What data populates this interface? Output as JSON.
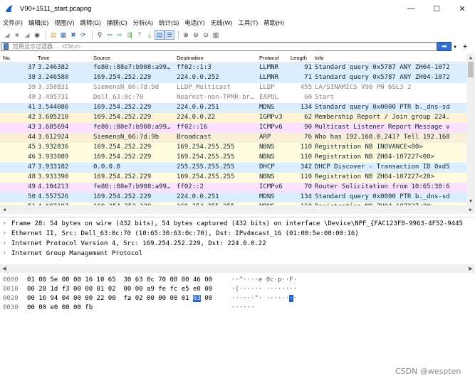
{
  "window": {
    "title": "V90+1511_start.pcapng",
    "minimize": "—",
    "maximize": "☐",
    "close": "✕"
  },
  "menu": [
    "文件(F)",
    "编辑(E)",
    "视图(V)",
    "跳转(G)",
    "捕获(C)",
    "分析(A)",
    "统计(S)",
    "电话(Y)",
    "无线(W)",
    "工具(T)",
    "帮助(H)"
  ],
  "toolbar_icons": [
    "shark-fin-start-icon",
    "stop-square-icon",
    "restart-fin-icon",
    "capture-options-gear-icon",
    "sep",
    "open-file-icon",
    "save-file-icon",
    "close-file-icon",
    "reload-icon",
    "sep",
    "find-packet-icon",
    "go-back-icon",
    "go-forward-icon",
    "go-to-packet-icon",
    "go-first-icon",
    "go-last-icon",
    "autoscroll-icon",
    "colorize-icon",
    "sep",
    "zoom-in-icon",
    "zoom-out-icon",
    "zoom-normal-icon",
    "resize-columns-icon"
  ],
  "filter": {
    "placeholder": "应用显示过滤器 … <Ctrl-/>",
    "apply": "➡",
    "dropdown": "▾",
    "add": "+"
  },
  "packet_list": {
    "columns": [
      "No.",
      "Time",
      "Source",
      "Destination",
      "Protocol",
      "Length",
      "Info"
    ],
    "rows": [
      {
        "no": "37",
        "time": "3.246382",
        "src": "fe80::88e7:b908:a99…",
        "dst": "ff02::1:3",
        "proto": "LLMNR",
        "len": "91",
        "info": "Standard query 0x5787 ANY ZH04-1072",
        "bg": "#daeeff",
        "fg": "#12272e"
      },
      {
        "no": "38",
        "time": "3.246580",
        "src": "169.254.252.229",
        "dst": "224.0.0.252",
        "proto": "LLMNR",
        "len": "71",
        "info": "Standard query 0x5787 ANY ZH04-1072",
        "bg": "#daeeff",
        "fg": "#12272e"
      },
      {
        "no": "39",
        "time": "3.358831",
        "src": "SiemensN_66:7d:9d",
        "dst": "LLDP_Multicast",
        "proto": "LLDP",
        "len": "455",
        "info": "LA/SINAMICS V90 PN            6SL3 2",
        "bg": "#ffffff",
        "fg": "#7f7f7f"
      },
      {
        "no": "40",
        "time": "3.495731",
        "src": "Dell_63:0c:70",
        "dst": "Nearest-non-TPMR-br…",
        "proto": "EAPOL",
        "len": "60",
        "info": "Start",
        "bg": "#ffffff",
        "fg": "#7f7f7f"
      },
      {
        "no": "41",
        "time": "3.544086",
        "src": "169.254.252.229",
        "dst": "224.0.0.251",
        "proto": "MDNS",
        "len": "134",
        "info": "Standard query 0x0000 PTR b._dns-sd",
        "bg": "#daeeff",
        "fg": "#12272e"
      },
      {
        "no": "42",
        "time": "3.605210",
        "src": "169.254.252.229",
        "dst": "224.0.0.22",
        "proto": "IGMPv3",
        "len": "62",
        "info": "Membership Report / Join group 224.",
        "bg": "#fff3d6",
        "fg": "#12272e"
      },
      {
        "no": "43",
        "time": "3.605694",
        "src": "fe80::88e7:b908:a99…",
        "dst": "ff02::16",
        "proto": "ICMPv6",
        "len": "90",
        "info": "Multicast Listener Report Message v",
        "bg": "#fce0ff",
        "fg": "#12272e"
      },
      {
        "no": "44",
        "time": "3.612924",
        "src": "SiemensN_66:7d:9b",
        "dst": "Broadcast",
        "proto": "ARP",
        "len": "76",
        "info": "Who has 192.168.0.241? Tell 192.168",
        "bg": "#faf0d7",
        "fg": "#12272e"
      },
      {
        "no": "45",
        "time": "3.932836",
        "src": "169.254.252.229",
        "dst": "169.254.255.255",
        "proto": "NBNS",
        "len": "110",
        "info": "Registration NB INOVANCE<00>",
        "bg": "#fffce0",
        "fg": "#12272e"
      },
      {
        "no": "46",
        "time": "3.933089",
        "src": "169.254.252.229",
        "dst": "169.254.255.255",
        "proto": "NBNS",
        "len": "110",
        "info": "Registration NB ZH04-107227<00>",
        "bg": "#fffce0",
        "fg": "#12272e"
      },
      {
        "no": "47",
        "time": "3.933182",
        "src": "0.0.0.0",
        "dst": "255.255.255.255",
        "proto": "DHCP",
        "len": "342",
        "info": "DHCP Discover - Transaction ID 0xd5",
        "bg": "#daeeff",
        "fg": "#12272e"
      },
      {
        "no": "48",
        "time": "3.933390",
        "src": "169.254.252.229",
        "dst": "169.254.255.255",
        "proto": "NBNS",
        "len": "110",
        "info": "Registration NB ZH04-107227<20>",
        "bg": "#fffce0",
        "fg": "#12272e"
      },
      {
        "no": "49",
        "time": "4.104213",
        "src": "fe80::88e7:b908:a99…",
        "dst": "ff02::2",
        "proto": "ICMPv6",
        "len": "70",
        "info": "Router Solicitation from 10:65:30:6",
        "bg": "#fce0ff",
        "fg": "#12272e"
      },
      {
        "no": "50",
        "time": "4.557526",
        "src": "169.254.252.229",
        "dst": "224.0.0.251",
        "proto": "MDNS",
        "len": "134",
        "info": "Standard query 0x0000 PTR b._dns-sd",
        "bg": "#daeeff",
        "fg": "#12272e"
      },
      {
        "no": "51",
        "time": "4.697197",
        "src": "169.254.252.229",
        "dst": "169.254.255.255",
        "proto": "NBNS",
        "len": "110",
        "info": "Registration NB ZH04-107227<20>",
        "bg": "#fffce0",
        "fg": "#12272e"
      }
    ]
  },
  "details": [
    {
      "caret": "›",
      "text": "Frame 28: 54 bytes on wire (432 bits), 54 bytes captured (432 bits) on interface \\Device\\NPF_{FAC123F8-9963-4F52-9445"
    },
    {
      "caret": "›",
      "text": "Ethernet II, Src: Dell_63:0c:70 (10:65:30:63:0c:70), Dst: IPv4mcast_16 (01:00:5e:00:00:16)"
    },
    {
      "caret": "›",
      "text": "Internet Protocol Version 4, Src: 169.254.252.229, Dst: 224.0.0.22"
    },
    {
      "caret": "›",
      "text": "Internet Group Management Protocol"
    }
  ],
  "bytes": [
    {
      "offset": "0000",
      "hex_a": "01 00 5e 00 00 16 10 65  30 63 0c 70 08 00 46 00",
      "hex_hl": "",
      "hex_b": "",
      "ascii_a": "··^····e 0c·p··F·",
      "ascii_hl": "",
      "ascii_b": ""
    },
    {
      "offset": "0010",
      "hex_a": "00 28 1d f3 00 00 01 02  00 00 a9 fe fc e5 e0 00",
      "hex_hl": "",
      "hex_b": "",
      "ascii_a": "·(······ ········",
      "ascii_hl": "",
      "ascii_b": ""
    },
    {
      "offset": "0020",
      "hex_a": "00 16 94 04 00 00 22 00  fa 02 00 00 00 01 ",
      "hex_hl": "03",
      "hex_b": " 00",
      "ascii_a": "······\"· ······",
      "ascii_hl": "·",
      "ascii_b": "·"
    },
    {
      "offset": "0030",
      "hex_a": "00 00 e0 00 00 fb",
      "hex_hl": "",
      "hex_b": "",
      "ascii_a": "······",
      "ascii_hl": "",
      "ascii_b": ""
    }
  ],
  "watermark": "CSDN @wespten"
}
